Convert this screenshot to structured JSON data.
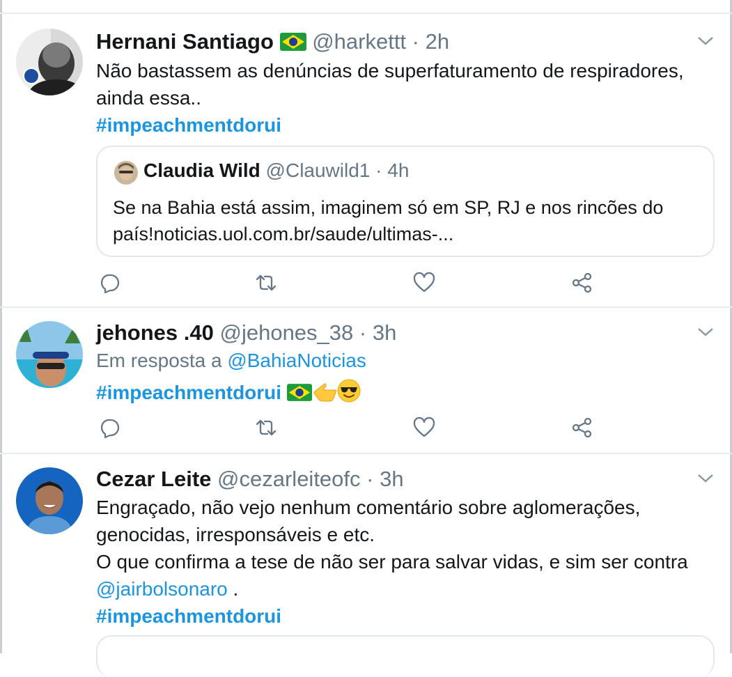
{
  "tweets": [
    {
      "name": "Hernani Santiago",
      "name_emoji": "brazil-flag",
      "handle": "@harkettt",
      "separator": "·",
      "time": "2h",
      "text_lines": [
        "Não bastassem as denúncias de superfaturamento de respiradores,",
        "ainda essa.."
      ],
      "hashtag": "#impeachmentdorui",
      "quote": {
        "name": "Claudia Wild",
        "handle": "@Clauwild1",
        "separator": "·",
        "time": "4h",
        "text_lines": [
          "Se na Bahia está assim, imaginem só em SP, RJ e nos rincões do",
          "país!noticias.uol.com.br/saude/ultimas-..."
        ]
      }
    },
    {
      "name": "jehones .40",
      "handle": "@jehones_38",
      "separator": "·",
      "time": "3h",
      "reply_prefix": "Em resposta a",
      "reply_to": "@BahiaNoticias",
      "hashtag": "#impeachmentdorui",
      "trailing_emojis": [
        "brazil-flag",
        "backhand-index-pointing-left",
        "smiling-face-with-sunglasses"
      ]
    },
    {
      "name": "Cezar Leite",
      "handle": "@cezarleiteofc",
      "separator": "·",
      "time": "3h",
      "text_lines": [
        "Engraçado, não vejo nenhum comentário sobre aglomerações,",
        "genocidas, irresponsáveis e etc.",
        "O que confirma a tese de não ser para salvar vidas, e sim ser contra"
      ],
      "mention": "@jairbolsonaro",
      "mention_suffix": " .",
      "hashtag": "#impeachmentdorui"
    }
  ],
  "colors": {
    "link": "#1b95e0",
    "secondary": "#657786",
    "divider": "#e6ecf0",
    "text": "#14171a"
  }
}
